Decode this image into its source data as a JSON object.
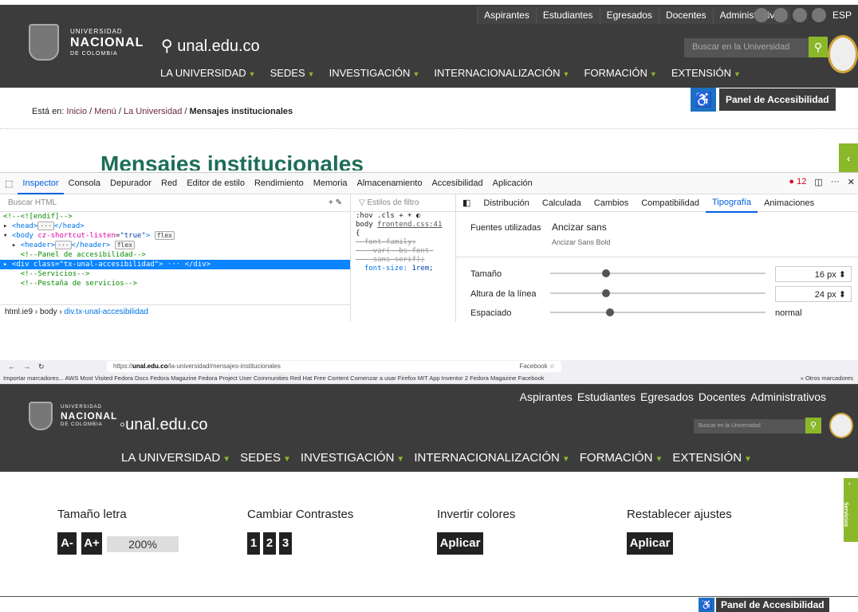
{
  "site": {
    "top_links": [
      "Aspirantes",
      "Estudiantes",
      "Egresados",
      "Docentes",
      "Administrativos"
    ],
    "lang": "ESP",
    "logo": {
      "line1": "UNIVERSIDAD",
      "line2": "NACIONAL",
      "line3": "DE COLOMBIA"
    },
    "domain": "unal.edu.co",
    "search_placeholder": "Buscar en la Universidad",
    "nav": [
      "LA UNIVERSIDAD",
      "SEDES",
      "INVESTIGACIÓN",
      "INTERNACIONALIZACIÓN",
      "FORMACIÓN",
      "EXTENSIÓN"
    ],
    "breadcrumb": {
      "prefix": "Está en:",
      "items": [
        "Inicio",
        "Menú",
        "La Universidad"
      ],
      "current": "Mensajes institucionales"
    },
    "accessibility_panel": "Panel de Accesibilidad",
    "page_title": "Mensajes institucionales",
    "side_tab": "‹"
  },
  "devtools": {
    "tabs": [
      "Inspector",
      "Consola",
      "Depurador",
      "Red",
      "Editor de estilo",
      "Rendimiento",
      "Memoria",
      "Almacenamiento",
      "Accesibilidad",
      "Aplicación"
    ],
    "errors": "12",
    "html_search": "Buscar HTML",
    "tree": {
      "l1": "<!--<![endif]-->",
      "l2": "<head>",
      "l2b": "</head>",
      "l3a": "<body ",
      "l3attr": "cz-shortcut-listen",
      "l3val": "\"true\"",
      "l3badge": "flex",
      "l4": "<header>",
      "l4b": "</header>",
      "l4badge": "flex",
      "l5": "<!--Panel de accesibilidad-->",
      "l6": "<div class=\"tx-unal-accesibilidad\">",
      "l6b": "</div>",
      "l7": "<!--Servicios-->",
      "l8": "<!--Pestaña de servicios-->"
    },
    "crumbs": [
      "html.ie9",
      "body",
      "div.tx-unal-accesibilidad"
    ],
    "filter_styles": "Estilos de filtro",
    "rules": {
      "pseudo": ":hov",
      ".cls": ".cls",
      "sel": "body",
      "file": "frontend.css:41",
      "p1": "font-family:",
      "p1v": "var(--bs-font-",
      "p1v2": "sans-serif);",
      "p2": "font-size:",
      "p2v": "1rem;"
    },
    "panel_tabs": [
      "Distribución",
      "Calculada",
      "Cambios",
      "Compatibilidad",
      "Tipografía",
      "Animaciones"
    ],
    "fonts_used_label": "Fuentes utilizadas",
    "font_name": "Ancizar sans",
    "font_sub": "Ancizar Sans Bold",
    "size_label": "Tamaño",
    "size_value": "16",
    "size_unit": "px",
    "size_level": 0.24,
    "lh_label": "Altura de la línea",
    "lh_value": "24",
    "lh_unit": "px",
    "lh_level": 0.24,
    "sp_label": "Espaciado",
    "sp_value": "normal",
    "sp_level": 0.26
  },
  "browser": {
    "url_prefix": "https://",
    "url_host": "unal.edu.co",
    "url_path": "/la-universidad/mensajes-institucionales",
    "facebook": "Facebook",
    "bookmarks": "Importar marcadores...  AWS  Most Visited  Fedora Docs  Fedora Magazine  Fedora Project  User Communities  Red Hat  Free Content  Comenzar a usar Firefox  MIT App Inventor 2  Fedora Magazine  Facebook",
    "other_bookmarks": "Otros marcadores"
  },
  "panel": {
    "font_size_title": "Tamaño letra",
    "a_minus": "A-",
    "a_plus": "A+",
    "percent": "200%",
    "contrast_title": "Cambiar Contrastes",
    "contrast_opts": [
      "1",
      "2",
      "3"
    ],
    "invert_title": "Invertir colores",
    "apply": "Aplicar",
    "reset_title": "Restablecer ajustes",
    "services": "Servicios",
    "panel_btn": "Panel de Accesibilidad"
  },
  "colors": {
    "accent": "#8bb82b",
    "dark": "#3c3c3c",
    "title_green": "#1d6e57",
    "blue": "#1c72c2"
  }
}
